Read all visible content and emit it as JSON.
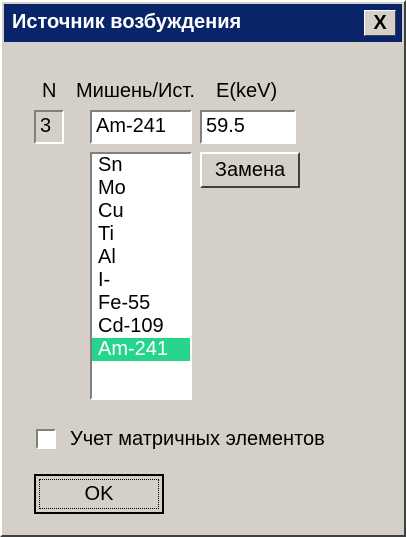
{
  "window": {
    "title": "Источник возбуждения",
    "close_glyph": "X"
  },
  "columns": {
    "n_label": "N",
    "target_label": "Мишень/Ист.",
    "energy_label": "E(keV)"
  },
  "fields": {
    "n_value": "3",
    "target_value": "Am-241",
    "energy_value": "59.5"
  },
  "source_list": {
    "items": [
      "Sn",
      "Mo",
      "Cu",
      "Ti",
      "Al",
      "I-",
      "Fe-55",
      "Cd-109",
      "Am-241"
    ],
    "selected": "Am-241"
  },
  "buttons": {
    "replace_label": "Замена",
    "ok_label": "OK"
  },
  "options": {
    "matrix_checkbox_label": "Учет матричных элементов",
    "matrix_checked": false
  },
  "colors": {
    "titlebar": "#0a246a",
    "selection": "#26d48c",
    "face": "#d4d0c8"
  }
}
